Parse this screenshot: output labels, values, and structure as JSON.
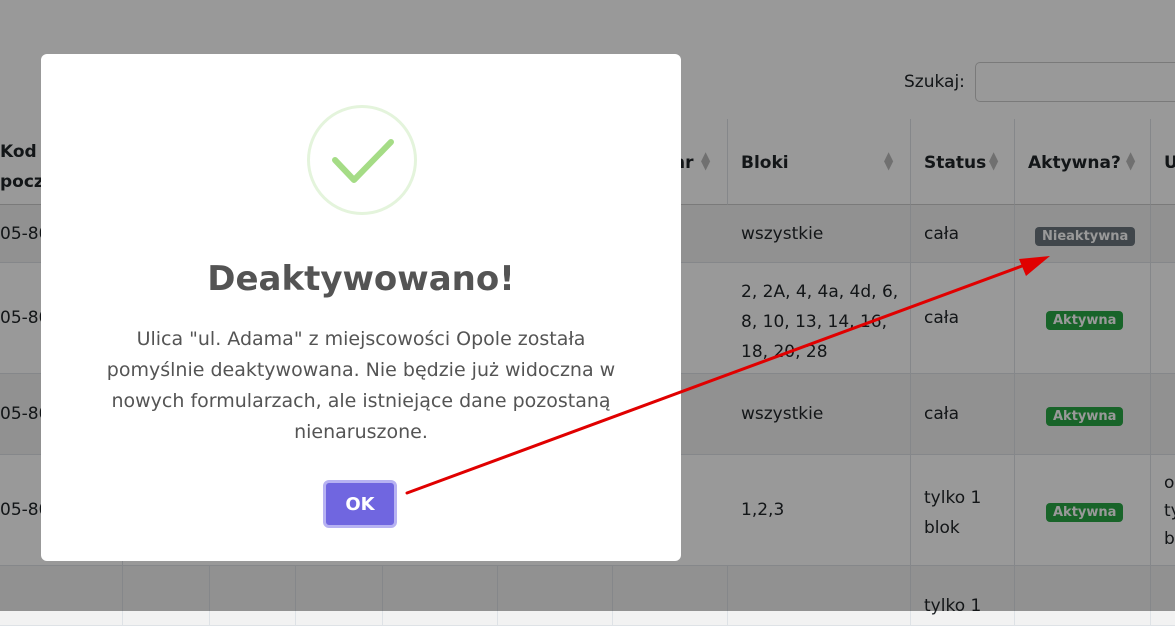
{
  "search": {
    "label": "Szukaj:",
    "value": ""
  },
  "table": {
    "headers": [
      "Kod pocz",
      "hr",
      "Bloki",
      "Status",
      "Aktywna?",
      "U"
    ],
    "rows": [
      {
        "kod": "05-80",
        "bloki": "wszystkie",
        "status": "cała",
        "aktywna": "Nieaktywna"
      },
      {
        "kod": "05-80",
        "bloki": "2, 2A, 4, 4a, 4d, 6, 8, 10, 13, 14, 16, 18, 20, 28",
        "status": "cała",
        "aktywna": "Aktywna"
      },
      {
        "kod": "05-80",
        "bloki": "wszystkie",
        "status": "cała",
        "aktywna": "Aktywna"
      },
      {
        "kod": "05-80",
        "bloki": "1,2,3",
        "status": "tylko 1 blok",
        "aktywna": "Aktywna",
        "extra": "o ty b"
      },
      {
        "kod": "",
        "bloki": "",
        "status": "tylko 1",
        "aktywna": ""
      }
    ]
  },
  "modal": {
    "title": "Deaktywowano!",
    "text": "Ulica \"ul. Adama\" z miejscowości Opole została pomyślnie deaktywowana. Nie będzie już widoczna w nowych formularzach, ale istniejące dane pozostaną nienaruszone.",
    "ok_label": "OK",
    "icon": "checkmark-icon"
  },
  "colors": {
    "primary_button": "#7066e0",
    "success": "#a5dc86",
    "badge_active": "#28a745",
    "badge_inactive": "#6c757d",
    "annotation_arrow": "#e00000"
  }
}
